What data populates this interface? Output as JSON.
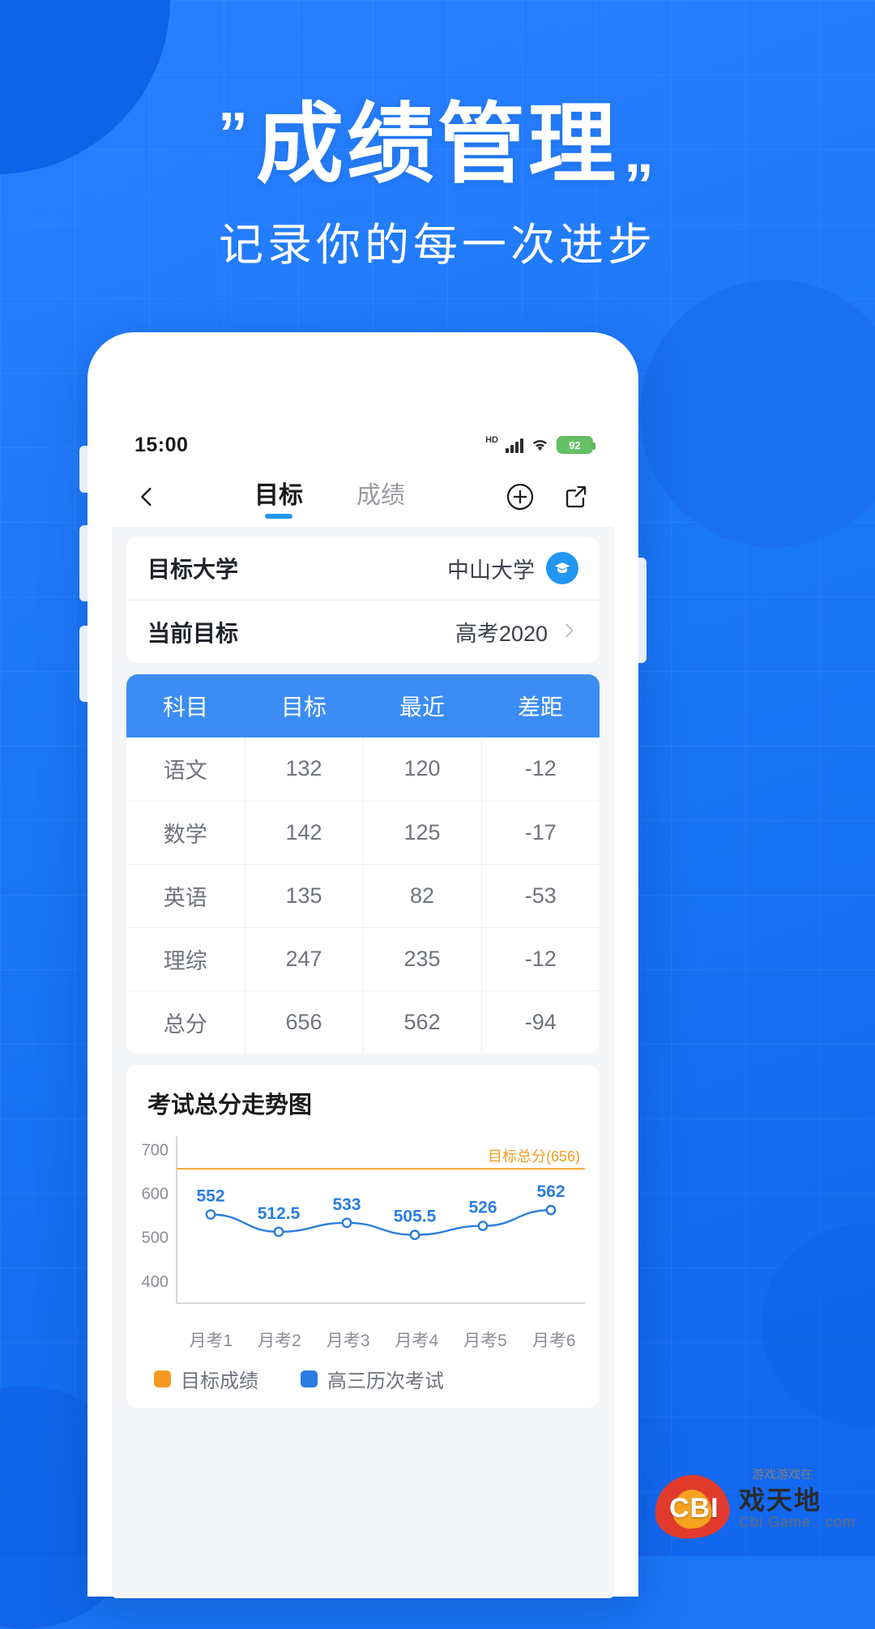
{
  "hero": {
    "quote_open": "”",
    "quote_close": "„",
    "title": "成绩管理",
    "subtitle": "记录你的每一次进步"
  },
  "statusbar": {
    "time": "15:00",
    "hd_label": "HD",
    "battery_level": "92",
    "signal_icon": "signal-bars-icon",
    "wifi_icon": "wifi-icon",
    "battery_icon": "battery-icon"
  },
  "navbar": {
    "back_icon": "chevron-left-icon",
    "tabs": [
      {
        "label": "目标",
        "active": true
      },
      {
        "label": "成绩",
        "active": false
      }
    ],
    "add_icon": "plus-circle-icon",
    "share_icon": "share-external-icon"
  },
  "goal_card": {
    "rows": [
      {
        "label": "目标大学",
        "value": "中山大学",
        "trailing": "graduation-cap-icon"
      },
      {
        "label": "当前目标",
        "value": "高考2020",
        "trailing": "chevron-right-icon"
      }
    ]
  },
  "score_table": {
    "headers": [
      "科目",
      "目标",
      "最近",
      "差距"
    ],
    "rows": [
      {
        "subject": "语文",
        "target": "132",
        "recent": "120",
        "gap": "-12"
      },
      {
        "subject": "数学",
        "target": "142",
        "recent": "125",
        "gap": "-17"
      },
      {
        "subject": "英语",
        "target": "135",
        "recent": "82",
        "gap": "-53"
      },
      {
        "subject": "理综",
        "target": "247",
        "recent": "235",
        "gap": "-12"
      },
      {
        "subject": "总分",
        "target": "656",
        "recent": "562",
        "gap": "-94"
      }
    ],
    "colors": {
      "header_bg": "#3b8cf5",
      "target": "#f0a020",
      "recent": "#2f7fe0",
      "gap": "#e8505a"
    }
  },
  "chart_card": {
    "title": "考试总分走势图",
    "legend": [
      {
        "label": "目标成绩",
        "color": "#f59a23"
      },
      {
        "label": "高三历次考试",
        "color": "#2a7de1"
      }
    ]
  },
  "chart_data": {
    "type": "line",
    "title": "考试总分走势图",
    "xlabel": "",
    "ylabel": "",
    "ylim": [
      350,
      730
    ],
    "yticks": [
      400,
      500,
      600,
      700
    ],
    "grid": false,
    "legend_position": "bottom-left",
    "categories": [
      "月考1",
      "月考2",
      "月考3",
      "月考4",
      "月考5",
      "月考6"
    ],
    "series": [
      {
        "name": "高三历次考试",
        "color": "#2a7de1",
        "values": [
          552,
          512.5,
          533,
          505.5,
          526,
          562
        ],
        "point_labels": [
          "552",
          "512.5",
          "533",
          "505.5",
          "526",
          "562"
        ]
      },
      {
        "name": "目标成绩",
        "color": "#f0a020",
        "type": "reference-line",
        "value": 656,
        "annotation": "目标总分(656)"
      }
    ]
  },
  "watermark": {
    "brand": "CBI",
    "site_cn": "戏天地",
    "site_url": "Cbi Game . com",
    "tagline": "游戏游戏在"
  }
}
